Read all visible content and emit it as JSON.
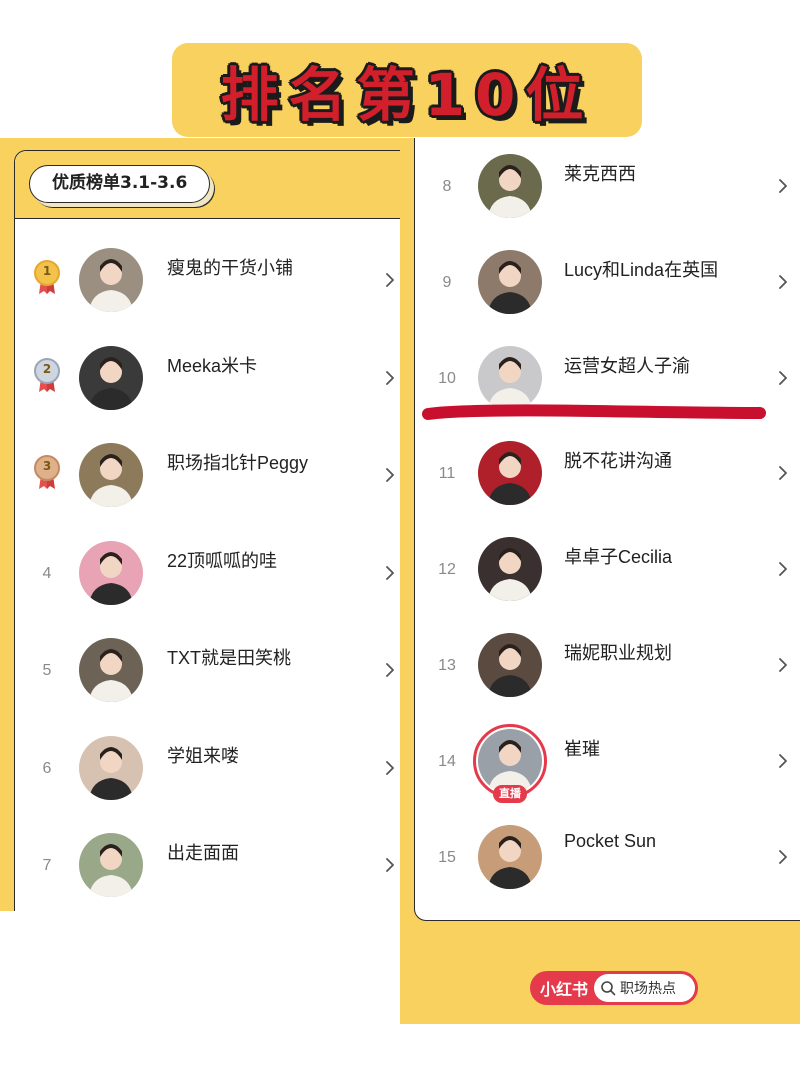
{
  "banner": {
    "title": "排名第10位"
  },
  "left_panel": {
    "tag": "优质榜单3.1-3.6",
    "items": [
      {
        "rank": "1",
        "name": "瘦鬼的干货小铺",
        "medal": "gold",
        "avatar_color": "#9a8f80"
      },
      {
        "rank": "2",
        "name": "Meeka米卡",
        "medal": "silver",
        "avatar_color": "#3a3a3a"
      },
      {
        "rank": "3",
        "name": "职场指北针Peggy",
        "medal": "bronze",
        "avatar_color": "#8c7a5a"
      },
      {
        "rank": "4",
        "name": "22顶呱呱的哇",
        "avatar_color": "#e8a3b4"
      },
      {
        "rank": "5",
        "name": "TXT就是田笑桃",
        "avatar_color": "#6c6256"
      },
      {
        "rank": "6",
        "name": "学姐来喽",
        "avatar_color": "#d7c2b2"
      },
      {
        "rank": "7",
        "name": "出走面面",
        "avatar_color": "#9aa88a"
      }
    ]
  },
  "right_panel": {
    "items": [
      {
        "rank": "8",
        "name": "莱克西西",
        "avatar_color": "#6b6a4d"
      },
      {
        "rank": "9",
        "name": "Lucy和Linda在英国",
        "avatar_color": "#8e7a6a"
      },
      {
        "rank": "10",
        "name": "运营女超人子渝",
        "avatar_color": "#c9c9cc"
      },
      {
        "rank": "11",
        "name": "脱不花讲沟通",
        "avatar_color": "#b0202a"
      },
      {
        "rank": "12",
        "name": "卓卓子Cecilia",
        "avatar_color": "#3b3030"
      },
      {
        "rank": "13",
        "name": "瑞妮职业规划",
        "avatar_color": "#5a4a40"
      },
      {
        "rank": "14",
        "name": "崔璀",
        "avatar_color": "#9aa0a8",
        "live_label": "直播"
      },
      {
        "rank": "15",
        "name": "Pocket Sun",
        "avatar_color": "#c79c78"
      }
    ]
  },
  "footer": {
    "brand": "小红书",
    "search_text": "职场热点"
  },
  "colors": {
    "yellow": "#f8d15f",
    "red": "#e43a4b",
    "text": "#222222",
    "rank": "#8a8a8a"
  }
}
